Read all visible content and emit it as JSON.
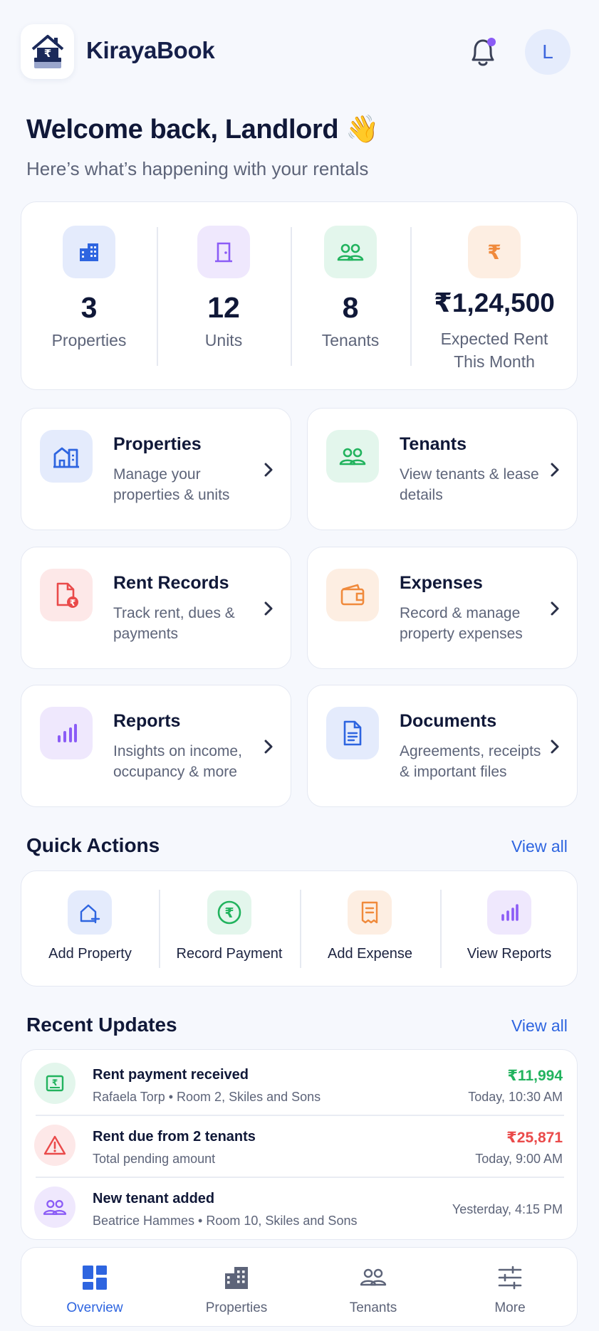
{
  "app": {
    "title": "KirayaBook",
    "avatar_initial": "L"
  },
  "welcome": {
    "heading": "Welcome back, Landlord 👋",
    "subtitle": "Here’s what’s happening with your rentals"
  },
  "stats": [
    {
      "icon": "building-icon",
      "value": "3",
      "label": "Properties"
    },
    {
      "icon": "door-icon",
      "value": "12",
      "label": "Units"
    },
    {
      "icon": "people-icon",
      "value": "8",
      "label": "Tenants"
    },
    {
      "icon": "rupee-icon",
      "value": "₹1,24,500",
      "label": "Expected Rent This Month"
    }
  ],
  "tiles": [
    {
      "icon": "house-icon",
      "title": "Properties",
      "desc": "Manage your properties & units"
    },
    {
      "icon": "people-icon",
      "title": "Tenants",
      "desc": "View tenants & lease details"
    },
    {
      "icon": "receipt-rupee-icon",
      "title": "Rent Records",
      "desc": "Track rent, dues & payments"
    },
    {
      "icon": "wallet-icon",
      "title": "Expenses",
      "desc": "Record & manage property expenses"
    },
    {
      "icon": "bar-chart-icon",
      "title": "Reports",
      "desc": "Insights on income, occupancy & more"
    },
    {
      "icon": "document-icon",
      "title": "Documents",
      "desc": "Agreements, receipts & important files"
    }
  ],
  "quick_actions": {
    "title": "Quick Actions",
    "view_all": "View all",
    "items": [
      {
        "icon": "add-home-icon",
        "label": "Add Property"
      },
      {
        "icon": "rupee-circle-icon",
        "label": "Record Payment"
      },
      {
        "icon": "receipt-icon",
        "label": "Add Expense"
      },
      {
        "icon": "bar-chart-icon",
        "label": "View Reports"
      }
    ]
  },
  "recent_updates": {
    "title": "Recent Updates",
    "view_all": "View all",
    "items": [
      {
        "icon": "rupee-note-icon",
        "title": "Rent payment received",
        "sub": "Rafaela Torp • Room 2, Skiles and Sons",
        "amount": "₹11,994",
        "time": "Today, 10:30 AM",
        "amount_color": "#22b35e"
      },
      {
        "icon": "warning-icon",
        "title": "Rent due from 2 tenants",
        "sub": "Total pending amount",
        "amount": "₹25,871",
        "time": "Today, 9:00 AM",
        "amount_color": "#ea4a4a"
      },
      {
        "icon": "people-icon",
        "title": "New tenant added",
        "sub": "Beatrice Hammes • Room 10, Skiles and Sons",
        "amount": "",
        "time": "Yesterday, 4:15 PM"
      }
    ]
  },
  "nav": [
    {
      "icon": "dashboard-icon",
      "label": "Overview",
      "active": true
    },
    {
      "icon": "building-icon",
      "label": "Properties"
    },
    {
      "icon": "people-icon",
      "label": "Tenants"
    },
    {
      "icon": "sliders-icon",
      "label": "More"
    }
  ],
  "colors": {
    "accent": "#2e65e0",
    "notification_dot": "#8b5cf6"
  }
}
